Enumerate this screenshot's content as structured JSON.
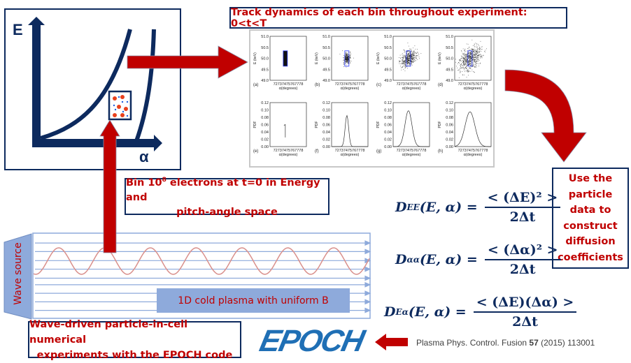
{
  "phase_space": {
    "y_axis_label": "E",
    "x_axis_label": "α"
  },
  "title_box": "Track dynamics of each bin throughout experiment: 0<t<T",
  "bin_box": {
    "line1_pre": "Bin 10",
    "sup": "8",
    "line1_post": " electrons at t=0 in Energy and",
    "line2": "pitch-angle space"
  },
  "use_box": [
    "Use the",
    "particle",
    "data to",
    "construct",
    "diffusion",
    "coefficients"
  ],
  "equations": [
    {
      "lhs": "D",
      "sub": "EE",
      "args": "(E, α) =",
      "num": "< (ΔE)² >",
      "den": "2Δt"
    },
    {
      "lhs": "D",
      "sub": "αα",
      "args": "(E, α) =",
      "num": "< (Δα)² >",
      "den": "2Δt"
    },
    {
      "lhs": "D",
      "sub": "Eα",
      "args": "(E, α) =",
      "num": "< (ΔE)(Δα) >",
      "den": "2Δt"
    }
  ],
  "wave_source": "Wave source",
  "plasma_label": "1D cold plasma with uniform B",
  "pic_box": [
    "Wave-driven particle-in-cell numerical",
    "experiments with the EPOCH code"
  ],
  "logo": "EPOCH",
  "citation": {
    "pre": "Plasma Phys. Control. Fusion ",
    "vol": "57",
    "post": " (2015) 113001"
  },
  "panels": {
    "x_ticks": "72737475767778",
    "x_label": "α(degrees)",
    "scatter": {
      "y_label": "E (keV)",
      "y_ticks": [
        "51.0",
        "50.5",
        "50.0",
        "49.5",
        "49.0"
      ],
      "labels": [
        "(a)",
        "(b)",
        "(c)",
        "(d)"
      ],
      "spread": [
        0,
        0.3,
        0.7,
        1.0
      ]
    },
    "pdf": {
      "y_label": "PDF",
      "y_ticks": [
        "0.12",
        "0.10",
        "0.08",
        "0.06",
        "0.04",
        "0.02",
        "0.00"
      ],
      "labels": [
        "(e)",
        "(f)",
        "(g)",
        "(h)"
      ],
      "peaks": [
        0.06,
        0.085,
        0.098,
        0.095
      ]
    }
  },
  "colors": {
    "navy": "#0d2a5e",
    "red": "#c00000",
    "wave_blue": "#8eaadb",
    "logo_blue": "#1f6fb5"
  }
}
